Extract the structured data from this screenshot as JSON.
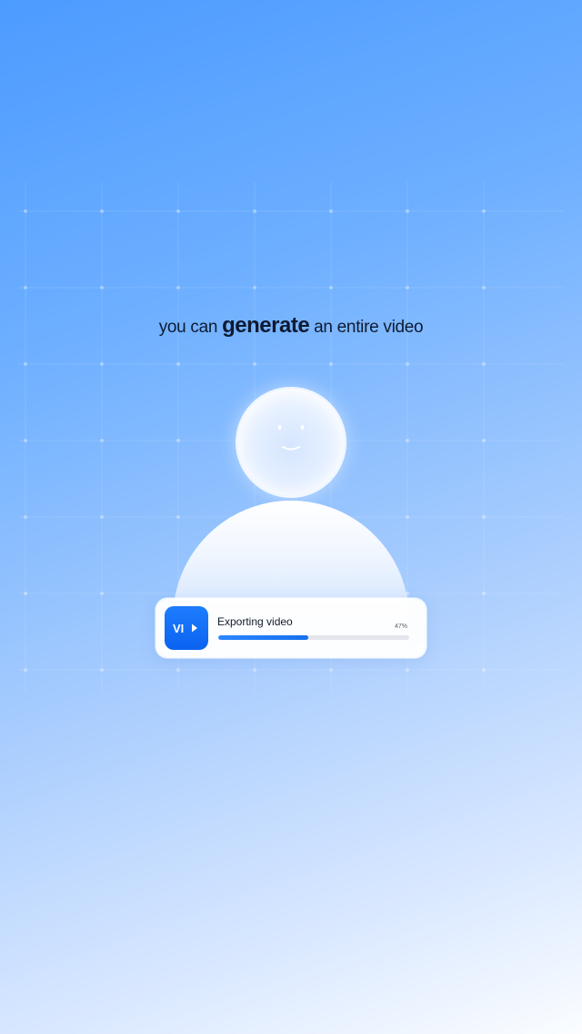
{
  "headline": {
    "prefix": "you can",
    "emphasis": "generate",
    "suffix": "an entire video"
  },
  "export_card": {
    "app_icon": "vi-play-logo-icon",
    "app_icon_text": "VI",
    "title": "Exporting video",
    "progress_label": "47%",
    "progress": 0.47
  },
  "colors": {
    "accent": "#0a63f0",
    "text_dark": "#0e1b33",
    "background_top": "#4c9bff",
    "background_bottom": "#fbfdff"
  }
}
